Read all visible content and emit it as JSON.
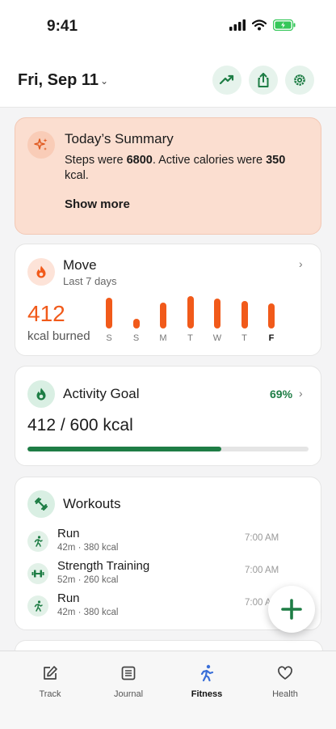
{
  "status_bar": {
    "time": "9:41"
  },
  "header": {
    "date": "Fri, Sep 11"
  },
  "summary": {
    "title": "Today’s Summary",
    "text_prefix": "Steps were ",
    "steps": "6800",
    "text_mid": ". Active calories were ",
    "calories": "350",
    "text_suffix": " kcal.",
    "more_label": "Show more"
  },
  "move": {
    "title": "Move",
    "subtitle": "Last 7 days",
    "value": "412",
    "unit": "kcal burned",
    "chart_data": {
      "type": "bar",
      "categories": [
        "S",
        "S",
        "M",
        "T",
        "W",
        "T",
        "F"
      ],
      "values": [
        0.95,
        0.3,
        0.8,
        1.0,
        0.92,
        0.85,
        0.78
      ],
      "current_index": 6,
      "color": "#f15a1a"
    }
  },
  "goal": {
    "title": "Activity Goal",
    "percent_label": "69%",
    "value": "412 / 600 kcal",
    "progress": 0.69,
    "color": "#1e7d45"
  },
  "workouts": {
    "title": "Workouts",
    "items": [
      {
        "name": "Run",
        "meta": "42m · 380 kcal",
        "time": "7:00 AM",
        "icon": "run-icon"
      },
      {
        "name": "Strength Training",
        "meta": "52m · 260 kcal",
        "time": "7:00 AM",
        "icon": "dumbbell-icon"
      },
      {
        "name": "Run",
        "meta": "42m · 380 kcal",
        "time": "7:00 AM",
        "icon": "run-icon"
      }
    ]
  },
  "nav": {
    "items": [
      {
        "label": "Track",
        "icon": "edit-icon"
      },
      {
        "label": "Journal",
        "icon": "journal-icon"
      },
      {
        "label": "Fitness",
        "icon": "fitness-icon",
        "active": true
      },
      {
        "label": "Health",
        "icon": "heart-icon"
      }
    ]
  },
  "colors": {
    "accent": "#1e7d45",
    "move": "#f15a1a",
    "summary_bg": "#fbded0"
  }
}
